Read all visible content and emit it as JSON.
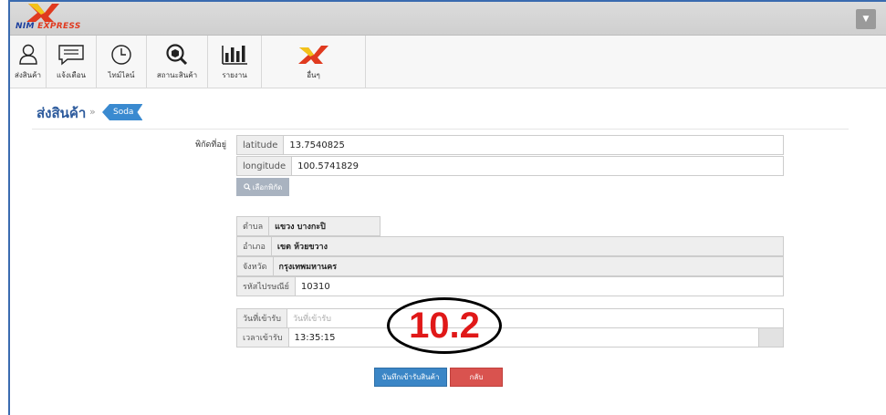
{
  "brand": {
    "logo_text_a": "NIM ",
    "logo_text_b": "EXPRESS"
  },
  "toolbar": {
    "items": [
      {
        "label": "ส่งสินค้า",
        "icon": "user-icon"
      },
      {
        "label": "แจ้งเตือน",
        "icon": "chat-icon"
      },
      {
        "label": "ไทม์ไลน์",
        "icon": "clock-icon"
      },
      {
        "label": "สถานะสินค้า",
        "icon": "search-box-icon"
      },
      {
        "label": "รายงาน",
        "icon": "bar-chart-icon"
      },
      {
        "label": "อื่นๆ",
        "icon": "nim-logo-icon"
      }
    ]
  },
  "page": {
    "title": "ส่งสินค้า",
    "separator": "»",
    "breadcrumb": "Soda"
  },
  "location": {
    "label": "พิกัดที่อยู่",
    "latitude_label": "latitude",
    "latitude_value": "13.7540825",
    "longitude_label": "longitude",
    "longitude_value": "100.5741829",
    "pick_button": "เลือกพิกัด"
  },
  "address": {
    "subdistrict_label": "ตำบล",
    "subdistrict_value": "แขวง บางกะปิ",
    "district_label": "อำเภอ",
    "district_value": "เขต ห้วยขวาง",
    "province_label": "จังหวัด",
    "province_value": "กรุงเทพมหานคร",
    "postcode_label": "รหัสไปรษณีย์",
    "postcode_value": "10310"
  },
  "receive": {
    "date_label": "วันที่เข้ารับ",
    "date_placeholder": "วันที่เข้ารับ",
    "time_label": "เวลาเข้ารับ",
    "time_value": "13:35:15"
  },
  "actions": {
    "save": "บันทึกเข้ารับสินค้า",
    "back": "กลับ"
  },
  "annotation": {
    "text": "10.2"
  },
  "colors": {
    "accent_blue": "#3b86c6",
    "danger_red": "#d9534f",
    "annotation_red": "#e01818"
  }
}
